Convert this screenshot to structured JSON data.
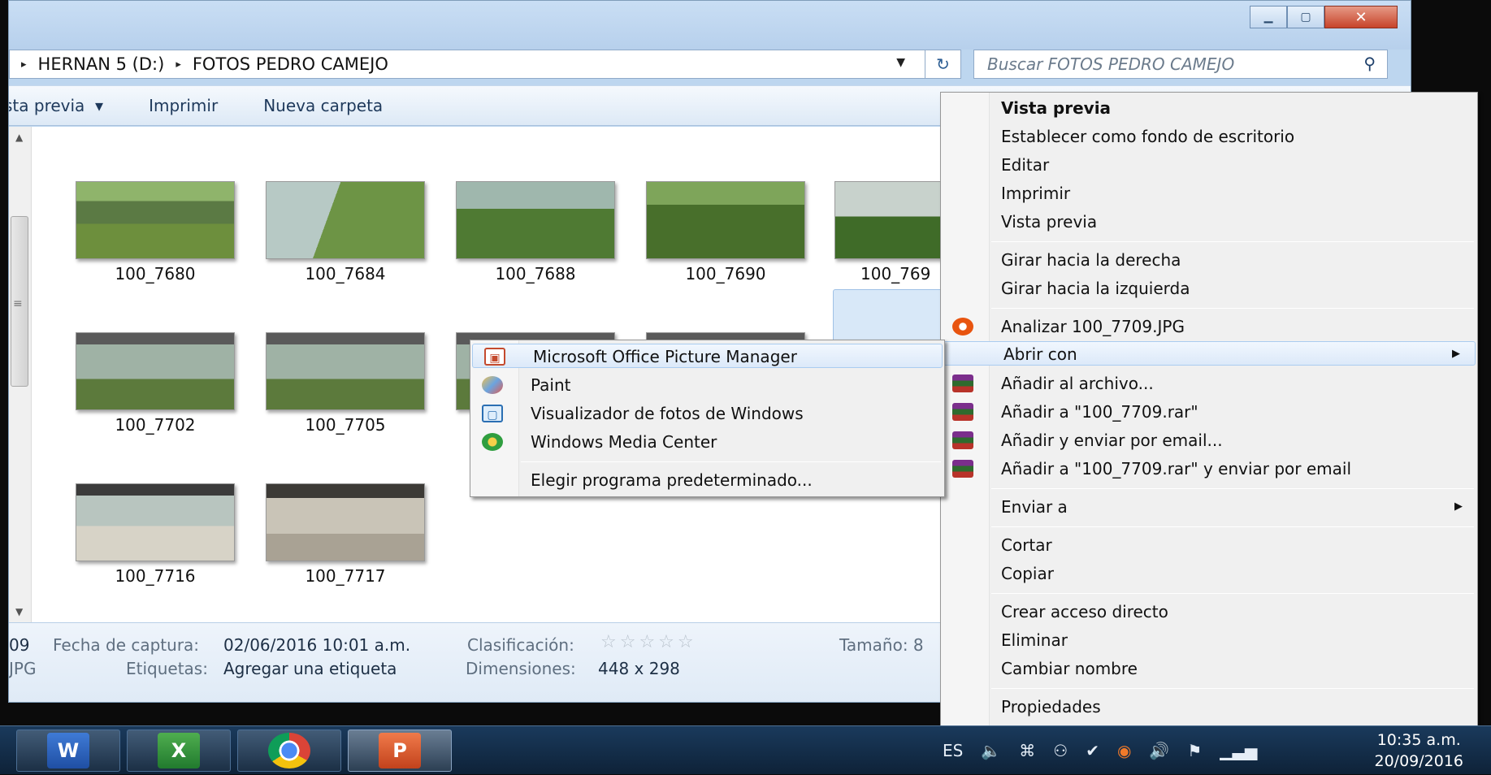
{
  "window": {
    "address_parts": [
      "HERNAN 5 (D:)",
      "FOTOS PEDRO CAMEJO"
    ],
    "search_placeholder": "Buscar FOTOS PEDRO CAMEJO",
    "toolbar": {
      "preview": "sta previa",
      "print": "Imprimir",
      "new_folder": "Nueva carpeta"
    }
  },
  "files": [
    {
      "name": "100_7680"
    },
    {
      "name": "100_7684"
    },
    {
      "name": "100_7688"
    },
    {
      "name": "100_7690"
    },
    {
      "name": "100_769"
    },
    {
      "name": "100_7702"
    },
    {
      "name": "100_7705"
    },
    {
      "name": "100_7716"
    },
    {
      "name": "100_7717"
    }
  ],
  "details": {
    "file_short": "09",
    "file_type": "JPG",
    "capture_label": "Fecha de captura:",
    "capture_value": "02/06/2016 10:01 a.m.",
    "tags_label": "Etiquetas:",
    "tags_value": "Agregar una etiqueta",
    "rating_label": "Clasificación:",
    "rating_stars": "☆☆☆☆☆",
    "dimensions_label": "Dimensiones:",
    "dimensions_value": "448 x 298",
    "size_label": "Tamaño: 8"
  },
  "context_menu": {
    "items": [
      {
        "label": "Vista previa",
        "bold": true
      },
      {
        "label": "Establecer como fondo de escritorio"
      },
      {
        "label": "Editar"
      },
      {
        "label": "Imprimir"
      },
      {
        "label": "Vista previa"
      },
      {
        "label": "Girar hacia la derecha"
      },
      {
        "label": "Girar hacia la izquierda"
      },
      {
        "label": "Analizar 100_7709.JPG",
        "icon": "antivirus-icon"
      },
      {
        "label": "Abrir con",
        "submenu": true
      },
      {
        "label": "Añadir al archivo...",
        "icon": "winrar-icon"
      },
      {
        "label": "Añadir a \"100_7709.rar\"",
        "icon": "winrar-icon"
      },
      {
        "label": "Añadir y enviar por email...",
        "icon": "winrar-icon"
      },
      {
        "label": "Añadir a \"100_7709.rar\" y enviar por email",
        "icon": "winrar-icon"
      },
      {
        "label": "Enviar a",
        "submenu": true
      },
      {
        "label": "Cortar"
      },
      {
        "label": "Copiar"
      },
      {
        "label": "Crear acceso directo"
      },
      {
        "label": "Eliminar"
      },
      {
        "label": "Cambiar nombre"
      },
      {
        "label": "Propiedades"
      }
    ]
  },
  "open_with_menu": {
    "items": [
      {
        "label": "Microsoft Office Picture Manager",
        "icon": "picture-manager-icon"
      },
      {
        "label": "Paint",
        "icon": "paint-icon"
      },
      {
        "label": "Visualizador de fotos de Windows",
        "icon": "photo-viewer-icon"
      },
      {
        "label": "Windows Media Center",
        "icon": "media-center-icon"
      },
      {
        "label": "Elegir programa predeterminado..."
      }
    ]
  },
  "taskbar": {
    "apps": [
      "word-icon",
      "excel-icon",
      "chrome-icon",
      "powerpoint-icon"
    ],
    "language": "ES",
    "time": "10:35 a.m.",
    "date": "20/09/2016"
  }
}
